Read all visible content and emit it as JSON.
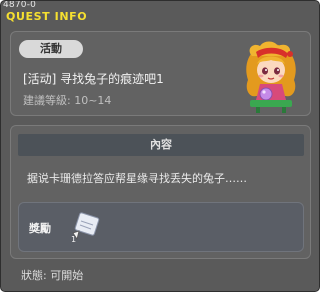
{
  "window": {
    "quest_code": "4870-0",
    "title": "QUEST INFO"
  },
  "quest": {
    "category": "活動",
    "name": "[活动] 寻找兔子的痕迹吧1",
    "level": "建議等級: 10~14",
    "npc_icon": "npc-portrait-icon"
  },
  "details": {
    "header": "內容",
    "description": "据说卡珊德拉答应帮星缘寻找丢失的兔子……",
    "reward_label": "獎勵",
    "reward_icon": "scroll-item-icon"
  },
  "status": {
    "text": "狀態: 可開始"
  },
  "colors": {
    "window_bg": "#5a5a5a",
    "title_yellow": "#f6e030",
    "panel_bg": "#626262",
    "header_bg": "#4c5258"
  }
}
